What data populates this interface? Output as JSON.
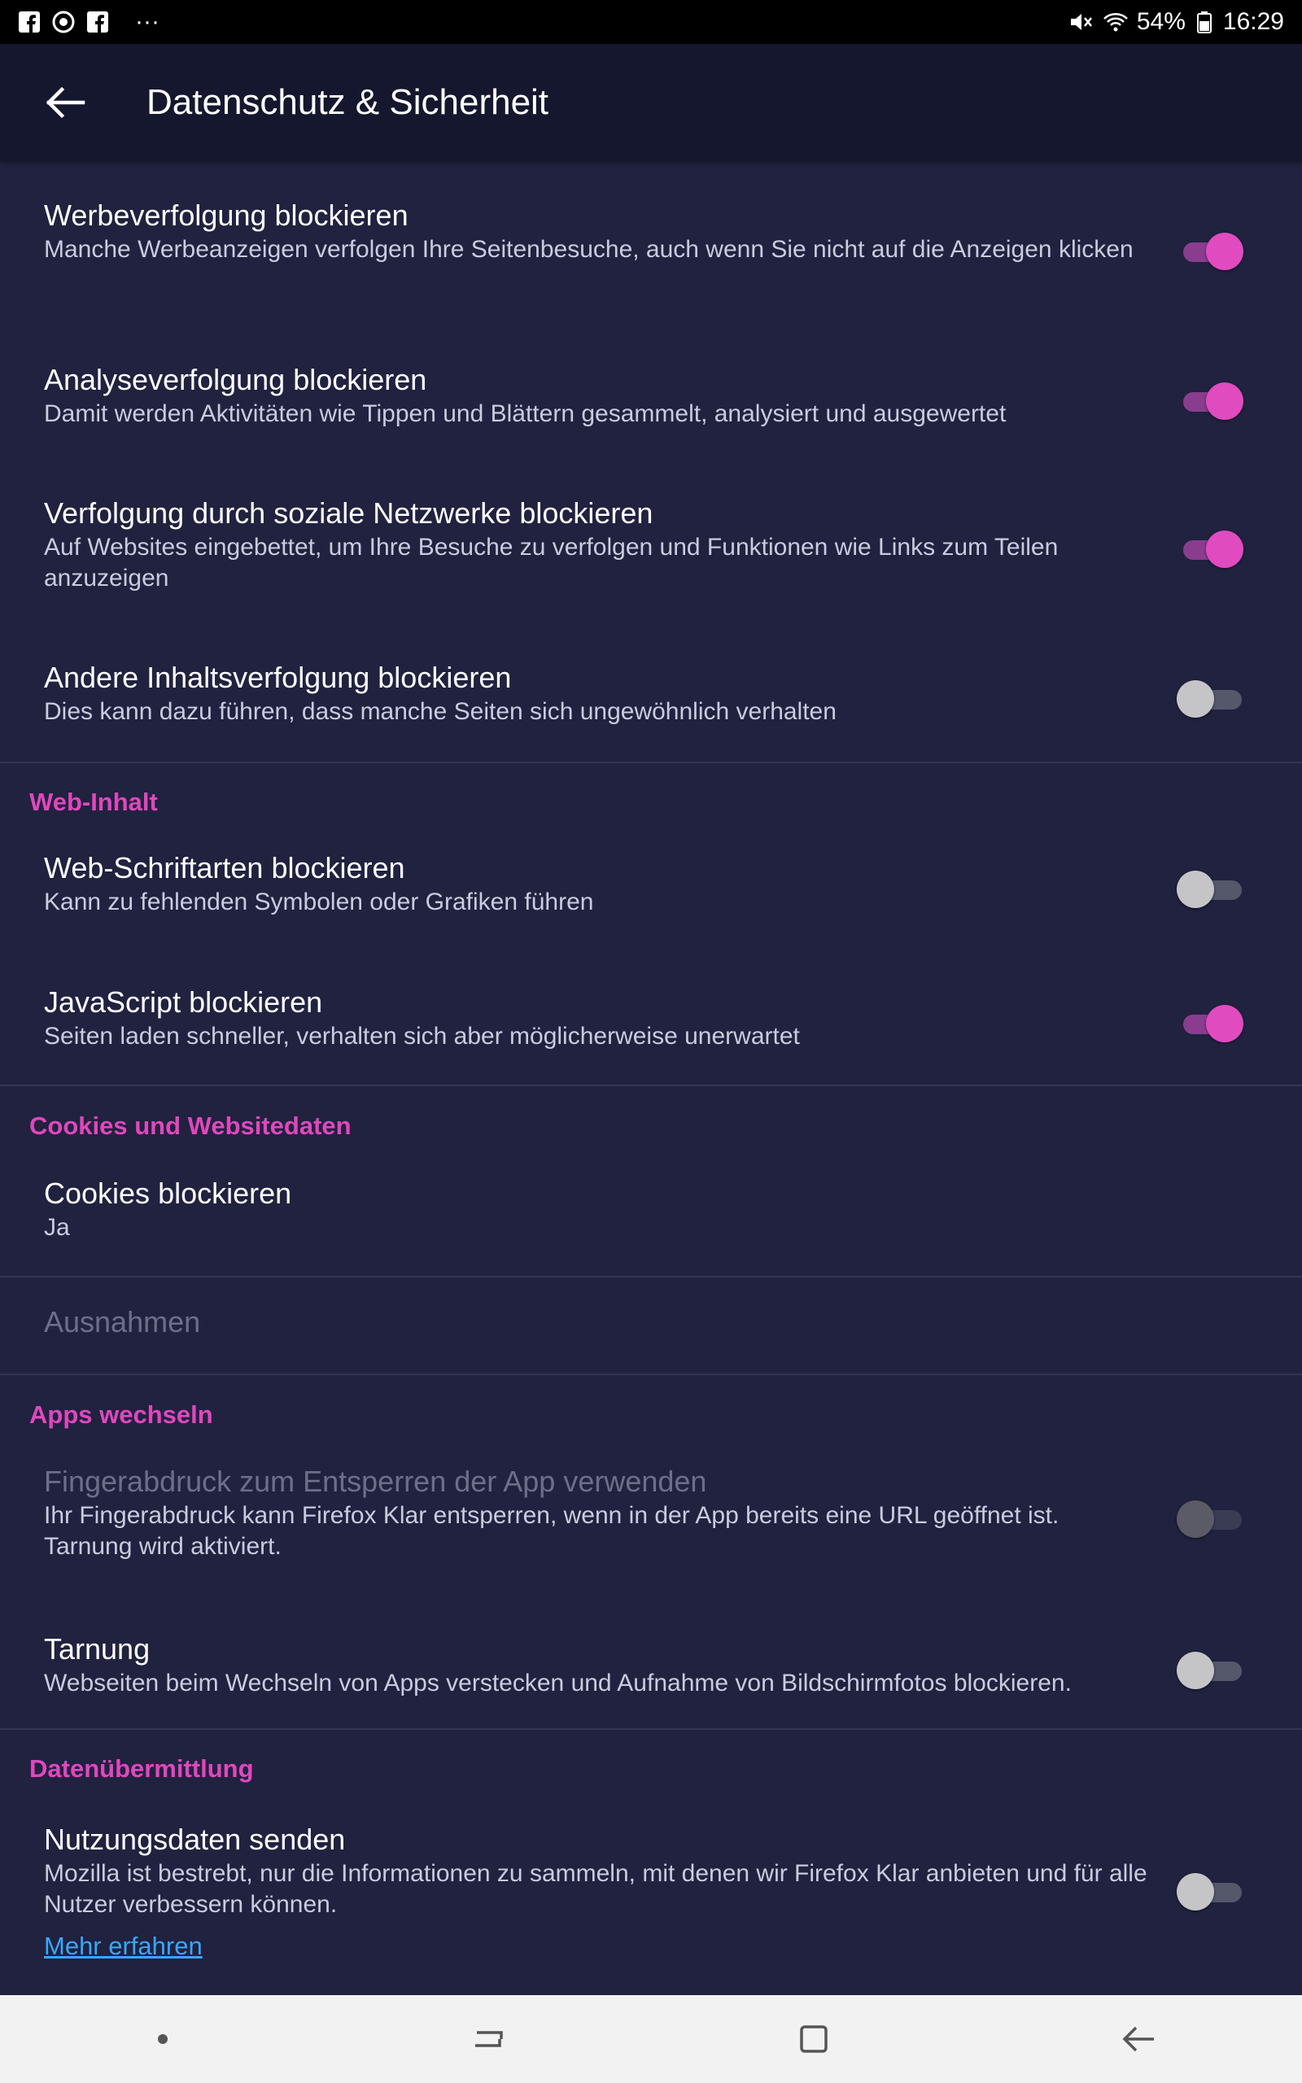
{
  "status_bar": {
    "battery": "54%",
    "time": "16:29",
    "more": "···"
  },
  "header": {
    "title": "Datenschutz & Sicherheit"
  },
  "rows": {
    "ad_tracking": {
      "title": "Werbeverfolgung blockieren",
      "sub": "Manche Werbeanzeigen verfolgen Ihre Seitenbesuche, auch wenn Sie nicht auf die Anzeigen klicken",
      "enabled": true
    },
    "analytics": {
      "title": "Analyseverfolgung blockieren",
      "sub": "Damit werden Aktivitäten wie Tippen und Blättern gesammelt, analysiert und ausgewertet",
      "enabled": true
    },
    "social": {
      "title": "Verfolgung durch soziale Netzwerke blockieren",
      "sub": "Auf Websites eingebettet, um Ihre Besuche zu verfolgen und Funktionen wie Links zum Teilen anzuzeigen",
      "enabled": true
    },
    "other_content": {
      "title": "Andere Inhaltsverfolgung blockieren",
      "sub": "Dies kann dazu führen, dass manche Seiten sich ungewöhnlich verhalten",
      "enabled": false
    },
    "web_fonts": {
      "title": "Web-Schriftarten blockieren",
      "sub": "Kann zu fehlenden Symbolen oder Grafiken führen",
      "enabled": false
    },
    "javascript": {
      "title": "JavaScript blockieren",
      "sub": "Seiten laden schneller, verhalten sich aber möglicherweise unerwartet",
      "enabled": true
    },
    "cookies": {
      "title": "Cookies blockieren",
      "value": "Ja"
    },
    "exceptions": {
      "title": "Ausnahmen"
    },
    "fingerprint": {
      "title": "Fingerabdruck zum Entsperren der App verwenden",
      "sub": "Ihr Fingerabdruck kann Firefox Klar entsperren, wenn in der App bereits eine URL geöffnet ist. Tarnung wird aktiviert.",
      "enabled": false
    },
    "stealth": {
      "title": "Tarnung",
      "sub": "Webseiten beim Wechseln von Apps verstecken und Aufnahme von Bildschirmfotos blockieren.",
      "enabled": false
    },
    "telemetry": {
      "title": "Nutzungsdaten senden",
      "sub": "Mozilla ist bestrebt, nur die Informationen zu sammeln, mit denen wir Firefox Klar anbieten und für alle Nutzer verbessern können.",
      "link": "Mehr erfahren",
      "enabled": false
    }
  },
  "sections": {
    "web_content": "Web-Inhalt",
    "cookies": "Cookies und Websitedaten",
    "switch_apps": "Apps wechseln",
    "data_transfer": "Datenübermittlung"
  },
  "colors": {
    "background": "#20223f",
    "appbar": "#15172e",
    "accent": "#e047bd",
    "link": "#3aa6ff"
  }
}
